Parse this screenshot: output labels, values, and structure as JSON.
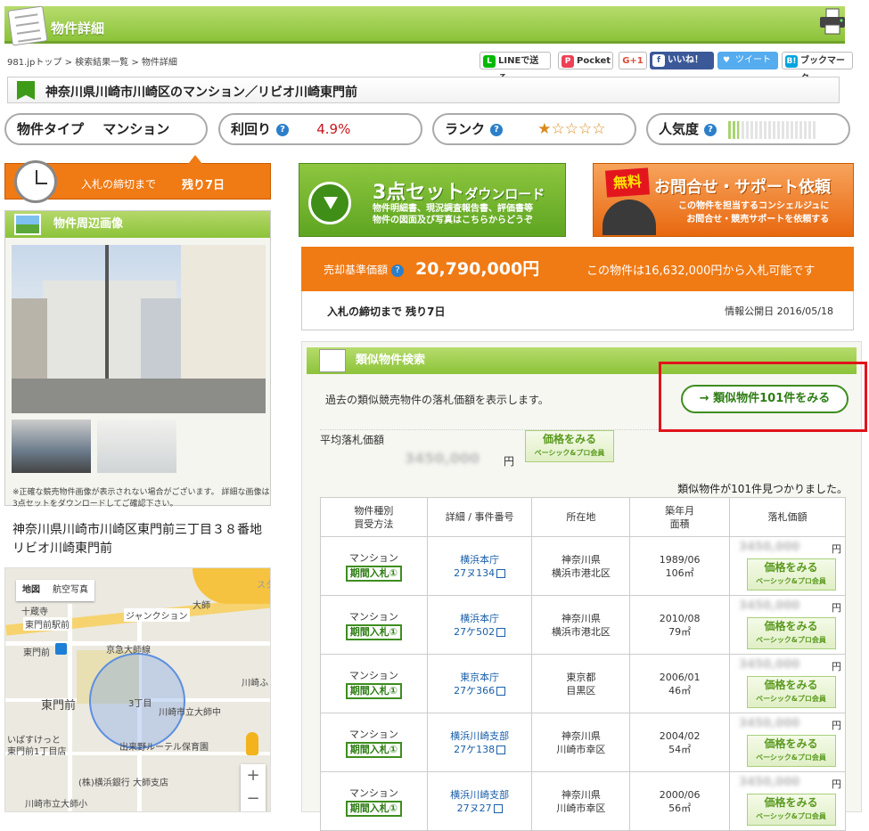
{
  "header": {
    "title": "物件詳細"
  },
  "breadcrumb": {
    "items": [
      "981.jpトップ",
      "検索結果一覧",
      "物件詳細"
    ],
    "sep": " > "
  },
  "share": {
    "line": "LINEで送る",
    "pocket": "Pocket",
    "gplus": "G+1",
    "facebook": "いいね！",
    "twitter": "ツイート",
    "hatena": "ブックマーク"
  },
  "property": {
    "title": "神奈川県川崎市川崎区のマンション／リビオ川崎東門前"
  },
  "pills": {
    "type_label": "物件タイプ",
    "type_value": "マンション",
    "yield_label": "利回り",
    "yield_value": "4.9%",
    "rank_label": "ランク",
    "rank_stars": "★☆☆☆☆",
    "popularity_label": "人気度"
  },
  "deadline": {
    "label": "入札の締切まで",
    "value": "残り7日"
  },
  "photos": {
    "title": "物件周辺画像"
  },
  "note": "※正確な競売物件画像が表示されない場合がございます。 詳細な画像は3点セットをダウンロードしてご確認下さい。",
  "address": {
    "line1": "神奈川県川崎市川崎区東門前三丁目３８番地",
    "line2": "リビオ川崎東門前"
  },
  "map": {
    "tab_map": "地図",
    "tab_aerial": "航空写真",
    "labels": [
      "十蔵寺",
      "大師",
      "ジャンクション",
      "東門前駅前",
      "京急大師線",
      "東門前",
      "東門前",
      "3丁目",
      "川崎市立大師中",
      "川崎ふ",
      "いばすけっと",
      "東門前1丁目店",
      "出来野ルーテル保育園",
      "(株)横浜銀行 大師支店",
      "川崎市立大師小",
      "スタ"
    ],
    "zoom_in": "+",
    "zoom_out": "−"
  },
  "download": {
    "title_main": "3点セット",
    "title_sub": "ダウンロード",
    "line1": "物件明細書、現況調査報告書、評価書等",
    "line2": "物件の図面及び写真はこちらからどうぞ"
  },
  "support": {
    "badge": "無料",
    "title": "お問合せ・サポート依頼",
    "line1": "この物件を担当するコンシェルジュに",
    "line2": "お問合せ・競売サポートを依頼する"
  },
  "price": {
    "label": "売却基準価額",
    "value": "20,790,000円",
    "note": "この物件は16,632,000円から入札可能です"
  },
  "info": {
    "deadline": "入札の締切まで 残り7日",
    "published": "情報公開日 2016/05/18"
  },
  "similar": {
    "title": "類似物件検索",
    "description": "過去の類似競売物件の落札価額を表示します。",
    "button": "→ 類似物件101件をみる",
    "avg_label": "平均落札価額",
    "avg_blur": "3450,000",
    "yen": "円",
    "price_btn": "価格をみる",
    "price_btn_sub": "ベーシック&プロ会員",
    "count_text": "類似物件が101件見つかりました。",
    "headers": {
      "type": "物件種別",
      "method": "買受方法",
      "case": "詳細 / 事件番号",
      "location": "所在地",
      "year": "築年月",
      "area": "面積",
      "price": "落札価額"
    },
    "rows": [
      {
        "type": "マンション",
        "method": "期間入札①",
        "court": "横浜本庁",
        "case_no": "27ヌ134",
        "pref": "神奈川県",
        "city": "横浜市港北区",
        "built": "1989/06",
        "area": "106㎡",
        "blur": "3450,000"
      },
      {
        "type": "マンション",
        "method": "期間入札①",
        "court": "横浜本庁",
        "case_no": "27ケ502",
        "pref": "神奈川県",
        "city": "横浜市港北区",
        "built": "2010/08",
        "area": "79㎡",
        "blur": "3450,000"
      },
      {
        "type": "マンション",
        "method": "期間入札①",
        "court": "東京本庁",
        "case_no": "27ケ366",
        "pref": "東京都",
        "city": "目黒区",
        "built": "2006/01",
        "area": "46㎡",
        "blur": "3450,000"
      },
      {
        "type": "マンション",
        "method": "期間入札①",
        "court": "横浜川崎支部",
        "case_no": "27ケ138",
        "pref": "神奈川県",
        "city": "川崎市幸区",
        "built": "2004/02",
        "area": "54㎡",
        "blur": "3450,000"
      },
      {
        "type": "マンション",
        "method": "期間入札①",
        "court": "横浜川崎支部",
        "case_no": "27ヌ27",
        "pref": "神奈川県",
        "city": "川崎市幸区",
        "built": "2000/06",
        "area": "56㎡",
        "blur": "3450,000"
      }
    ]
  },
  "colors": {
    "green": "#8cc33a",
    "orange": "#f07a14",
    "red": "#e0141a",
    "blue": "#1a5fa8"
  }
}
